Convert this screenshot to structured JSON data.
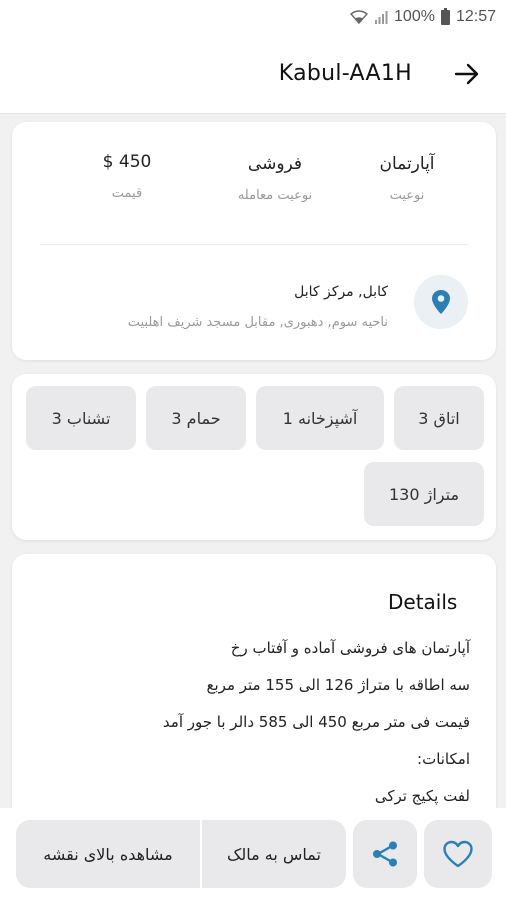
{
  "status_bar": {
    "battery": "100%",
    "time": "12:57"
  },
  "header": {
    "title": "Kabul-AA1H"
  },
  "summary": {
    "type": {
      "value": "آپارتمان",
      "label": "نوعیت"
    },
    "deal": {
      "value": "فروشی",
      "label": "نوعیت معامله"
    },
    "price": {
      "value": "$ 450",
      "label": "قیمت"
    }
  },
  "location": {
    "title": "کابل, مرکز کابل",
    "address": "ناحیه سوم, دهبوری, مقابل مسجد شریف اهلبیت"
  },
  "features": {
    "rooms": "اتاق 3",
    "kitchen": "آشپزخانه 1",
    "bath": "حمام 3",
    "toilet": "تشناب 3",
    "area": "متراژ 130"
  },
  "details": {
    "title": "Details",
    "lines": [
      "آپارتمان های فروشی آماده و آفتاب رخ",
      "سه اطاقه با متراژ 126 الی 155 متر مربع",
      "قیمت فی متر مربع 450 الی 585 دالر با جور آمد",
      "امکانات:",
      "لفت پکیج ترکی"
    ]
  },
  "actions": {
    "map": "مشاهده بالای نقشه",
    "contact": "تماس به مالک"
  },
  "colors": {
    "accent": "#2b7fb8",
    "chip_bg": "#e9e9ec",
    "muted_text": "#9a9a9a"
  }
}
